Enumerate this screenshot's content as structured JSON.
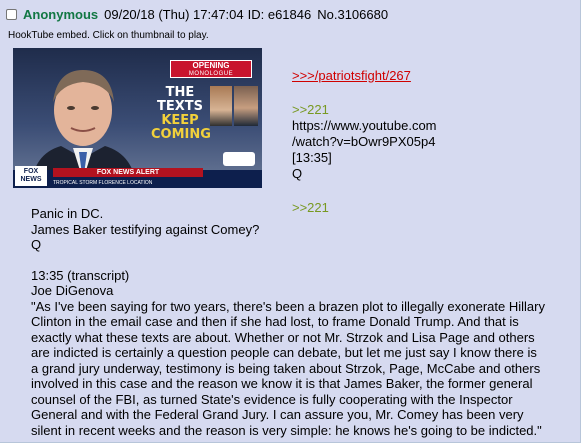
{
  "post": {
    "name": "Anonymous",
    "datetime": "09/20/18 (Thu) 17:47:04",
    "id_label": "ID: e61846",
    "number": "No.3106680",
    "file_info": "HookTube embed. Click on thumbnail to play."
  },
  "thumbnail": {
    "opening_title": "OPENING",
    "opening_sub": "MONOLOGUE",
    "headline_1": "THE",
    "headline_2": "TEXTS",
    "headline_3": "KEEP",
    "headline_4": "COMING",
    "alert_text": "FOX NEWS ALERT",
    "logo_text": "FOX NEWS",
    "location_text": "TROPICAL STORM FLORENCE   LOCATION"
  },
  "right_col": {
    "link_cross": ">>>/patriotsfight/267",
    "reply_1": ">>221",
    "url_line_1": "https://www.youtube.com",
    "url_line_2": "/watch?v=bOwr9PX05p4",
    "timestamp": "[13:35]",
    "q_signature": "Q",
    "reply_2": ">>221"
  },
  "body": {
    "line_1": "Panic in DC.",
    "line_2": "James Baker testifying against Comey?",
    "line_3": "Q",
    "line_4": "13:35 (transcript)",
    "line_5": "Joe DiGenova",
    "quote_lines": [
      "\"As I've been saying for two years, there's been a brazen plot to illegally exonerate Hillary",
      "Clinton in the email case and then if she had lost, to frame Donald Trump. And that is",
      "exactly what these texts are about. Whether or not Mr. Strzok and Lisa Page and others",
      "are indicted is certainly a question people can debate, but let me just say I know there is",
      "a grand jury underway, testimony is being taken about Strzok, Page, McCabe and others",
      "involved in this case and the reason we know it is that James Baker, the former general",
      "counsel of the FBI, as turned State's evidence is fully cooperating with the Inspector",
      "General and with the Federal Grand Jury. I can assure you, Mr. Comey has been very",
      "silent in recent weeks and the reason is very simple: he knows he's going to be indicted.\""
    ]
  },
  "colors": {
    "background": "#d6daf0",
    "name_green": "#117743",
    "quotelink_red": "#d00000",
    "greentext": "#789922"
  }
}
